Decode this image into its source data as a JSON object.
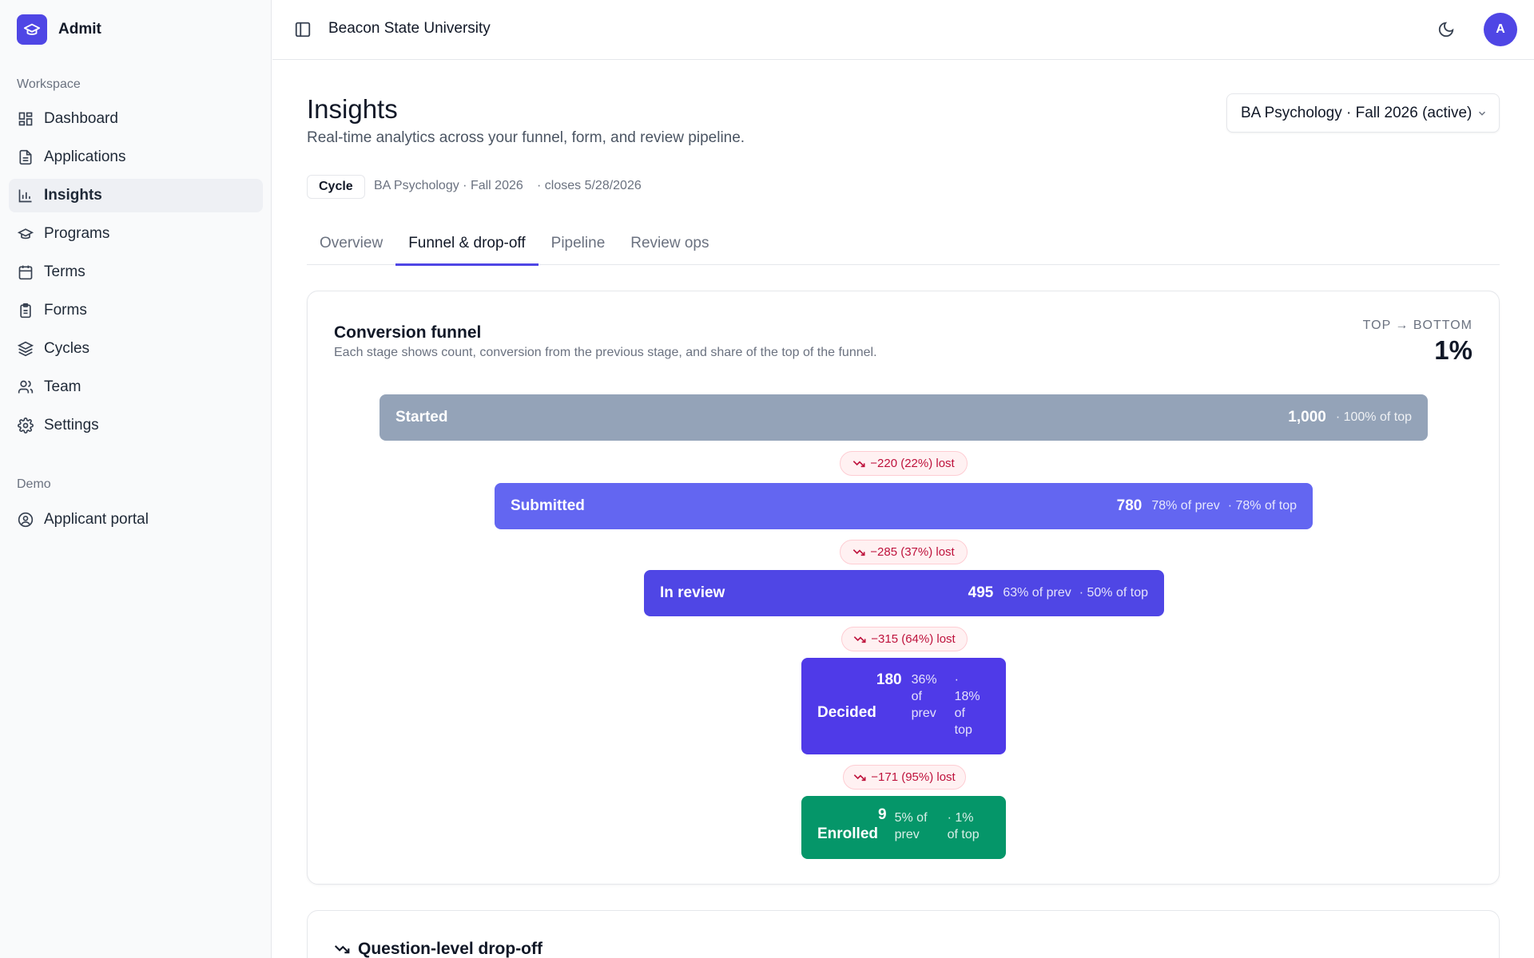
{
  "app": {
    "name": "Admit",
    "accent": "#4f46e5"
  },
  "sidebar": {
    "workspace_label": "Workspace",
    "items": [
      {
        "label": "Dashboard",
        "icon": "dashboard-icon"
      },
      {
        "label": "Applications",
        "icon": "document-icon"
      },
      {
        "label": "Insights",
        "icon": "bar-chart-icon",
        "active": true
      },
      {
        "label": "Programs",
        "icon": "graduation-cap-icon"
      },
      {
        "label": "Terms",
        "icon": "calendar-icon"
      },
      {
        "label": "Forms",
        "icon": "clipboard-icon"
      },
      {
        "label": "Cycles",
        "icon": "layers-icon"
      },
      {
        "label": "Team",
        "icon": "users-icon"
      },
      {
        "label": "Settings",
        "icon": "gear-icon"
      }
    ],
    "demo_label": "Demo",
    "demo_items": [
      {
        "label": "Applicant portal",
        "icon": "user-circle-icon"
      }
    ]
  },
  "topbar": {
    "org_name": "Beacon State University",
    "avatar_initial": "A"
  },
  "page": {
    "title": "Insights",
    "subtitle": "Real-time analytics across your funnel, form, and review pipeline.",
    "program_select": "BA Psychology · Fall 2026 (active)",
    "cycle_badge": "Cycle",
    "cycle_name": "BA Psychology · Fall 2026",
    "cycle_closes": "· closes 5/28/2026"
  },
  "tabs": [
    {
      "label": "Overview"
    },
    {
      "label": "Funnel & drop-off",
      "active": true
    },
    {
      "label": "Pipeline"
    },
    {
      "label": "Review ops"
    }
  ],
  "funnel": {
    "title": "Conversion funnel",
    "subtitle": "Each stage shows count, conversion from the previous stage, and share of the top of the funnel.",
    "top_bottom_label": "TOP → BOTTOM",
    "top_bottom_value": "1%",
    "stages": [
      {
        "name": "Started",
        "count": "1,000",
        "pct_prev": "",
        "share": "· 100% of top",
        "color": "#94a3b8",
        "share_of_top": 1.0
      },
      {
        "name": "Submitted",
        "count": "780",
        "pct_prev": "78% of prev",
        "share": "· 78% of top",
        "color": "#6366f1",
        "share_of_top": 0.78
      },
      {
        "name": "In review",
        "count": "495",
        "pct_prev": "63% of prev",
        "share": "· 50% of top",
        "color": "#4f46e5",
        "share_of_top": 0.5
      },
      {
        "name": "Decided",
        "count": "180",
        "pct_prev": "36% of prev",
        "share": "· 18% of top",
        "color": "#4f3ae8",
        "share_of_top": 0.18
      },
      {
        "name": "Enrolled",
        "count": "9",
        "pct_prev": "5% of prev",
        "share": "· 1% of top",
        "color": "#059669",
        "share_of_top": 0.01
      }
    ],
    "losses": [
      "−220 (22%) lost",
      "−285 (37%) lost",
      "−315 (64%) lost",
      "−171 (95%) lost"
    ]
  },
  "question_dropoff": {
    "title": "Question-level drop-off"
  }
}
